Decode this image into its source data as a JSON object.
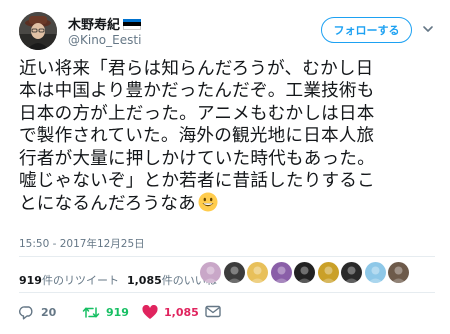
{
  "user": {
    "display_name": "木野寿紀",
    "handle": "@Kino_Eesti"
  },
  "follow_button_label": "フォローする",
  "tweet": {
    "lines": [
      "近い将来「君らは知らんだろうが、むかし日",
      "本は中国より豊かだったんだぞ。工業技術も",
      "日本の方が上だった。アニメもむかしは日本",
      "で製作されていた。海外の観光地に日本人旅",
      "行者が大量に押しかけていた時代もあった。",
      "嘘じゃないぞ」とか若者に昔話したりするこ",
      "とになるんだろうなあ"
    ],
    "emoji": "grinning-face-emoji",
    "timestamp": "15:50 - 2017年12月25日"
  },
  "stats": {
    "retweets_num": "919",
    "retweets_label": "件のリツイート",
    "likes_num": "1,085",
    "likes_label": "件のいいね"
  },
  "actions": {
    "reply_count": "20",
    "retweet_count": "919",
    "like_count": "1,085"
  },
  "colors": {
    "accent": "#1da1f2",
    "retweet": "#17bf63",
    "like": "#e0245e",
    "secondary_text": "#657786",
    "flag": [
      "#0072ce",
      "#000000",
      "#ffffff"
    ]
  },
  "liker_avatar_colors": [
    "#c9a7c8",
    "#3c3c3c",
    "#e8c05a",
    "#8a5fa8",
    "#222222",
    "#caa028",
    "#2a2a2a",
    "#8ec8e8",
    "#6d5a4a"
  ]
}
